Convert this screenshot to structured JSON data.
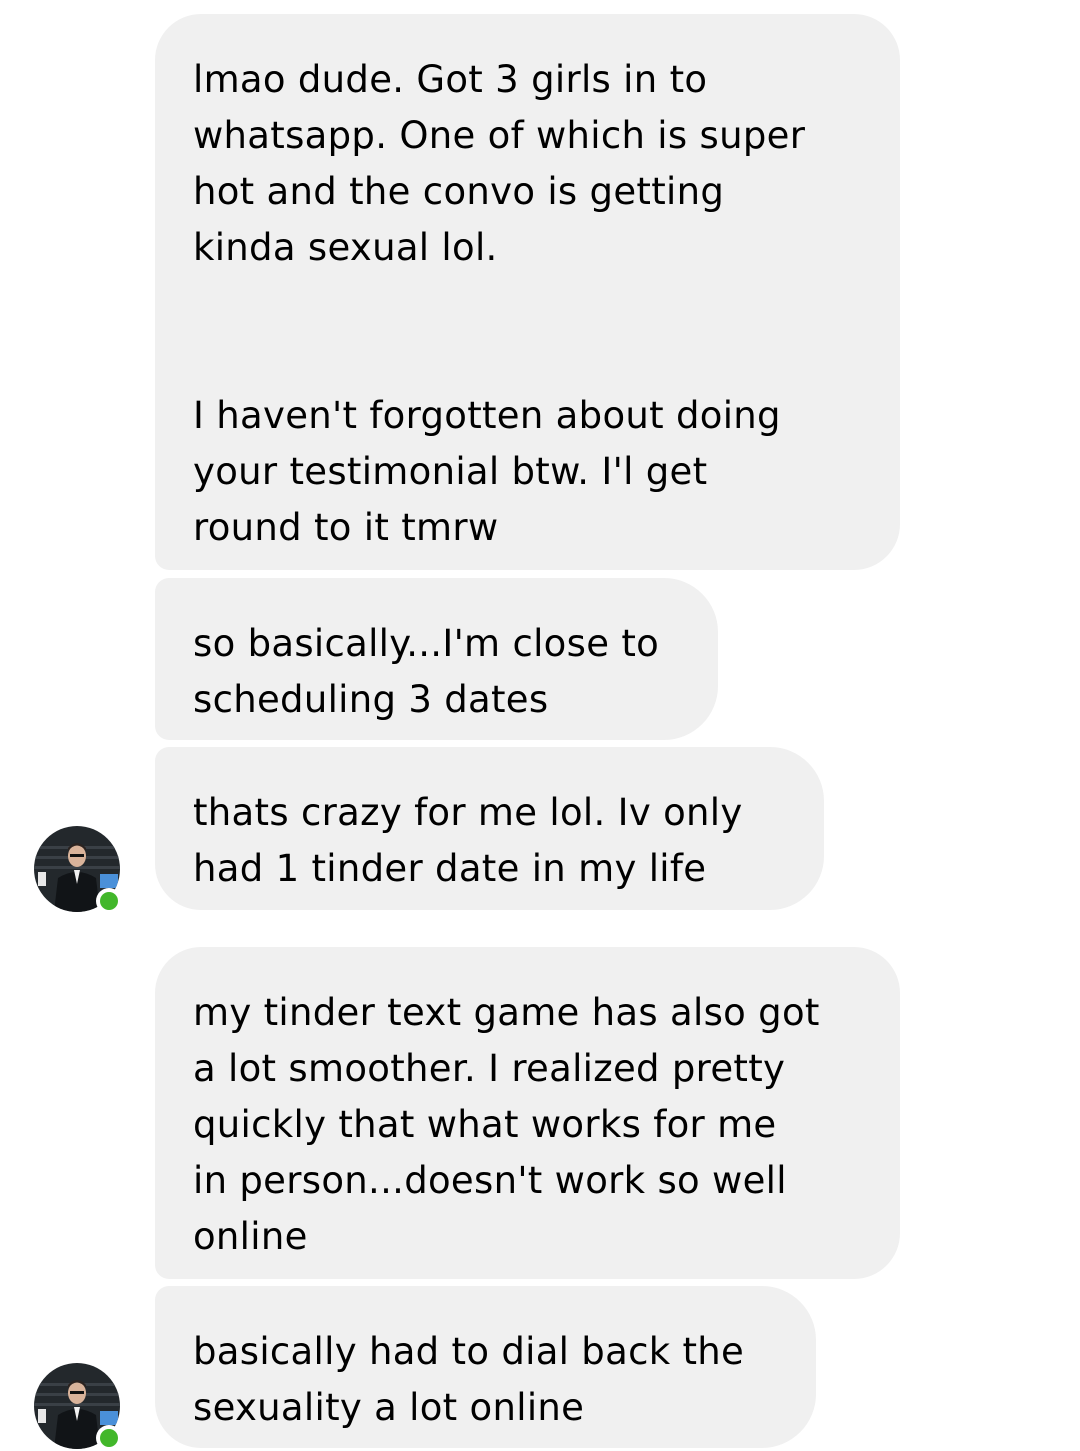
{
  "conversation": {
    "messages": [
      {
        "paragraphs": [
          [
            "lmao dude. Got 3 girls in to",
            "whatsapp. One of which is super",
            "hot and the convo is getting",
            "kinda sexual lol."
          ],
          [
            "I haven't forgotten about doing",
            "your testimonial btw. I'l get",
            "round to it tmrw"
          ]
        ]
      },
      {
        "paragraphs": [
          [
            "so basically...I'm close to",
            "scheduling 3 dates"
          ]
        ]
      },
      {
        "paragraphs": [
          [
            "thats crazy for me lol. Iv only",
            "had 1 tinder date in my life"
          ]
        ]
      },
      {
        "paragraphs": [
          [
            "my tinder text game has also got",
            "a lot smoother. I realized pretty",
            "quickly that what works for me",
            "in person...doesn't work so well",
            "online"
          ]
        ]
      },
      {
        "paragraphs": [
          [
            "basically had to dial back the",
            "sexuality a lot online"
          ]
        ]
      }
    ]
  },
  "colors": {
    "bubble_background": "#f0f0f0",
    "text": "#000000",
    "online_indicator": "#42b72a",
    "page_background": "#ffffff"
  },
  "icons": {
    "avatar": "profile-photo",
    "presence": "online-status-dot"
  }
}
